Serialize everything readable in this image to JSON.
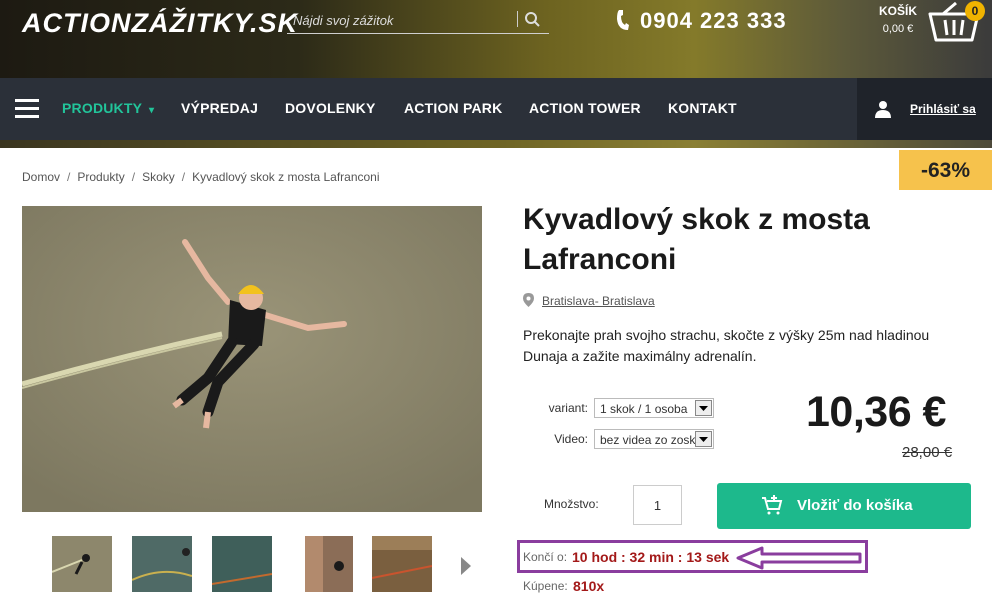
{
  "header": {
    "logo": "ACTIONZÁŽITKY.SK",
    "search_placeholder": "Nájdi svoj zážitok",
    "phone": "0904 223 333",
    "cart_label": "KOŠÍK",
    "cart_total": "0,00 €",
    "cart_count": "0"
  },
  "nav": {
    "items": [
      "PRODUKTY",
      "VÝPREDAJ",
      "DOVOLENKY",
      "ACTION PARK",
      "ACTION TOWER",
      "KONTAKT"
    ],
    "dropdown_marker": "▾",
    "login": "Prihlásiť sa"
  },
  "breadcrumb": [
    "Domov",
    "Produkty",
    "Skoky",
    "Kyvadlový skok z mosta Lafranconi"
  ],
  "breadcrumb_sep": "/",
  "discount": "-63%",
  "product": {
    "title": "Kyvadlový skok z mosta Lafranconi",
    "location": "Bratislava- Bratislava",
    "description": "Prekonajte prah svojho strachu, skočte z výšky  25m nad hladinou Dunaja a zažite maximálny adrenalín.",
    "variant_label": "variant:",
    "variant_value": "1 skok / 1 osoba",
    "video_label": "Video:",
    "video_value": "bez videa zo zosk",
    "price": "10,36 €",
    "old_price": "28,00 €",
    "qty_label": "Množstvo:",
    "qty_value": "1",
    "add_to_cart": "Vložiť do košíka",
    "ends_label": "Končí o:",
    "ends_value": "10 hod : 32 min : 13 sek",
    "bought_label": "Kúpene:",
    "bought_value": "810x"
  },
  "colors": {
    "nav_bg": "#2b3039",
    "accent_green": "#1db98c",
    "discount_bg": "#f6c24c",
    "countdown_red": "#a31919",
    "highlight_purple": "#8a3d9e"
  }
}
